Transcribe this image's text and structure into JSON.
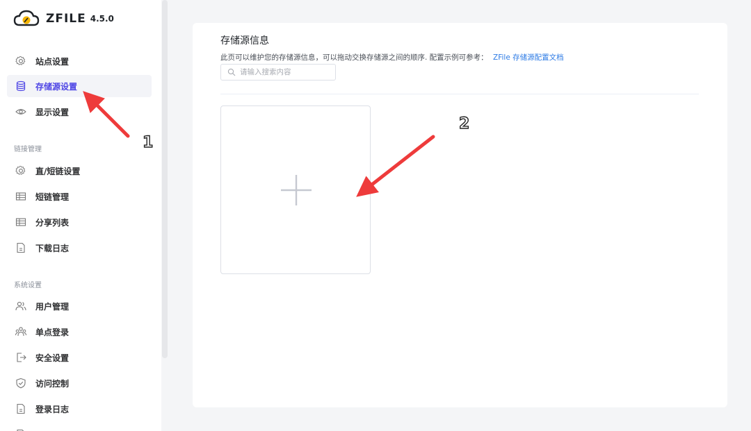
{
  "app": {
    "brand": "ZFILE",
    "version": "4.5.0"
  },
  "sidebar": {
    "items": [
      {
        "label": "站点设置",
        "icon": "gear-icon"
      },
      {
        "label": "存储源设置",
        "icon": "database-icon",
        "active": true
      },
      {
        "label": "显示设置",
        "icon": "eye-icon"
      }
    ],
    "link_section_label": "链接管理",
    "link_items": [
      {
        "label": "直/短链设置",
        "icon": "gear-icon"
      },
      {
        "label": "短链管理",
        "icon": "table-icon"
      },
      {
        "label": "分享列表",
        "icon": "table-icon"
      },
      {
        "label": "下载日志",
        "icon": "document-icon"
      }
    ],
    "system_section_label": "系统设置",
    "system_items": [
      {
        "label": "用户管理",
        "icon": "users-icon"
      },
      {
        "label": "单点登录",
        "icon": "user-group-icon"
      },
      {
        "label": "安全设置",
        "icon": "logout-icon"
      },
      {
        "label": "访问控制",
        "icon": "shield-check-icon"
      },
      {
        "label": "登录日志",
        "icon": "document-icon"
      }
    ]
  },
  "main": {
    "title": "存储源信息",
    "description": "此页可以维护您的存储源信息，可以拖动交换存储源之间的顺序. 配置示例可参考：",
    "doc_link": "ZFile 存储源配置文档",
    "search": {
      "placeholder": "请输入搜索内容",
      "value": ""
    }
  },
  "annotations": {
    "arrow1_label": "1",
    "arrow2_label": "2",
    "arrow_color": "#ee3b3b"
  },
  "colors": {
    "accent": "#4f46e5",
    "link": "#2d7be5"
  }
}
